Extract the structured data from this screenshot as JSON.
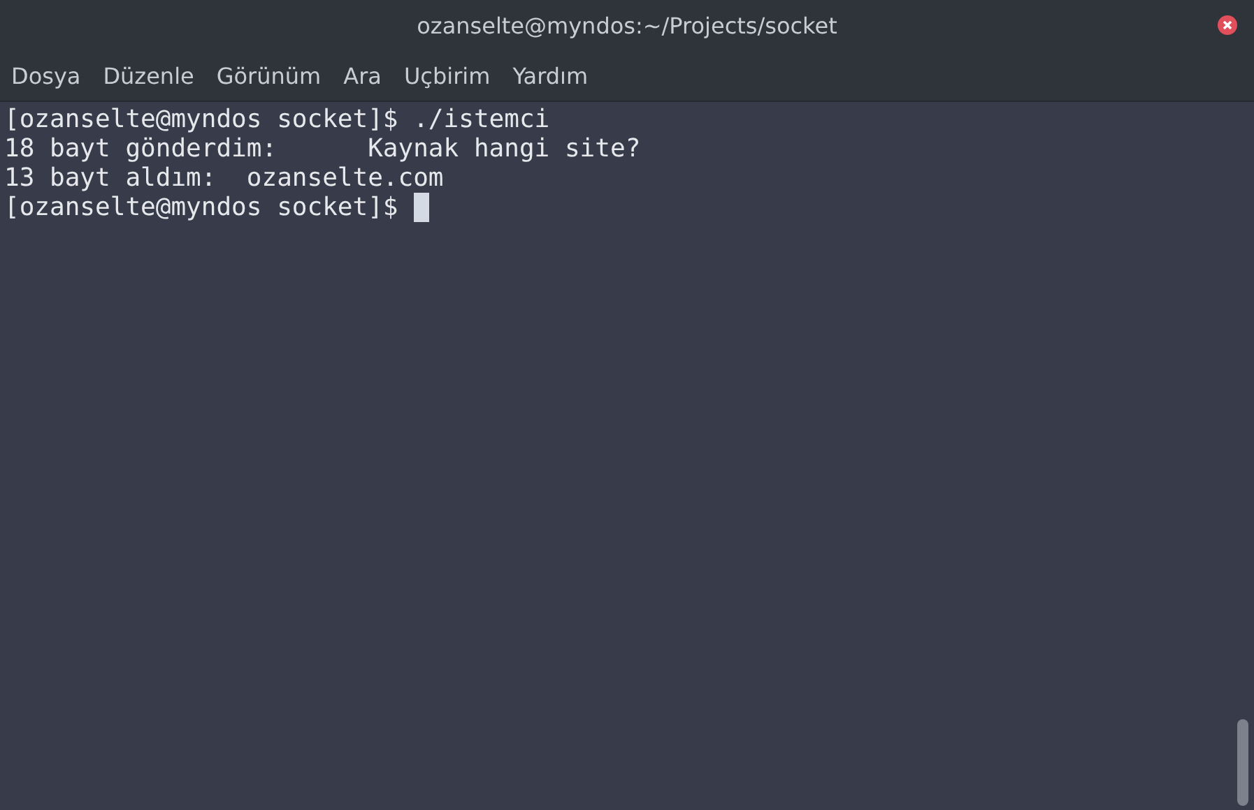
{
  "window": {
    "title": "ozanselte@myndos:~/Projects/socket"
  },
  "menu": [
    {
      "label": "Dosya"
    },
    {
      "label": "Düzenle"
    },
    {
      "label": "Görünüm"
    },
    {
      "label": "Ara"
    },
    {
      "label": "Uçbirim"
    },
    {
      "label": "Yardım"
    }
  ],
  "terminal": {
    "lines": [
      "[ozanselte@myndos socket]$ ./istemci",
      "18 bayt gönderdim:      Kaynak hangi site?",
      "13 bayt aldım:  ozanselte.com",
      "[ozanselte@myndos socket]$ "
    ],
    "cursor": true
  }
}
